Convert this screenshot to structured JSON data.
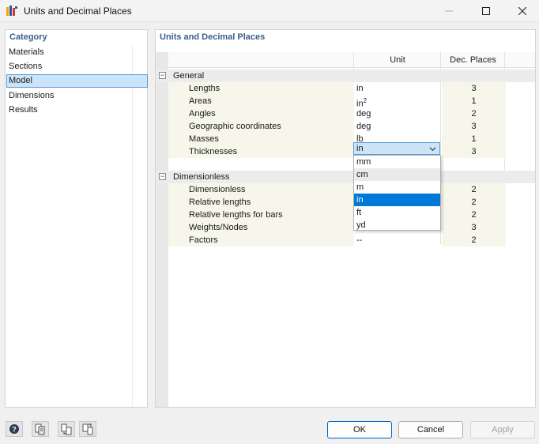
{
  "window": {
    "title": "Units and Decimal Places"
  },
  "categories": {
    "header": "Category",
    "items": [
      {
        "label": "Materials"
      },
      {
        "label": "Sections"
      },
      {
        "label": "Model"
      },
      {
        "label": "Dimensions"
      },
      {
        "label": "Results"
      }
    ],
    "selected": "Model"
  },
  "main": {
    "header": "Units and Decimal Places",
    "columns": {
      "unit": "Unit",
      "dec": "Dec. Places"
    },
    "groups": [
      {
        "label": "General",
        "toggle": "−",
        "rows": [
          {
            "label": "Lengths",
            "unit": "in",
            "dec": "3"
          },
          {
            "label": "Areas",
            "unit": "in",
            "unit_sup": "2",
            "dec": "1"
          },
          {
            "label": "Angles",
            "unit": "deg",
            "dec": "2"
          },
          {
            "label": "Geographic coordinates",
            "unit": "deg",
            "dec": "3"
          },
          {
            "label": "Masses",
            "unit": "lb",
            "dec": "1"
          },
          {
            "label": "Thicknesses",
            "unit": "in",
            "dec": "3"
          }
        ]
      },
      {
        "label": "Dimensionless",
        "toggle": "−",
        "rows": [
          {
            "label": "Dimensionless",
            "unit": "",
            "dec": "2"
          },
          {
            "label": "Relative lengths",
            "unit": "",
            "dec": "2"
          },
          {
            "label": "Relative lengths for bars",
            "unit": "",
            "dec": "2"
          },
          {
            "label": "Weights/Nodes",
            "unit": "",
            "dec": "3"
          },
          {
            "label": "Factors",
            "unit": "--",
            "dec": "2"
          }
        ]
      }
    ]
  },
  "combo": {
    "value": "in",
    "arrow_icon": "chevron-down-icon",
    "options": [
      "mm",
      "cm",
      "m",
      "in",
      "ft",
      "yd"
    ],
    "selected": "in",
    "hover": "cm"
  },
  "footer": {
    "ok": "OK",
    "cancel": "Cancel",
    "apply": "Apply",
    "tools": [
      "help-icon",
      "copy-units-icon",
      "import-units-icon",
      "export-units-icon"
    ]
  },
  "colors": {
    "accent": "#0078d7",
    "header_text": "#3a5f8a",
    "selection_bg": "#cce4f7"
  }
}
